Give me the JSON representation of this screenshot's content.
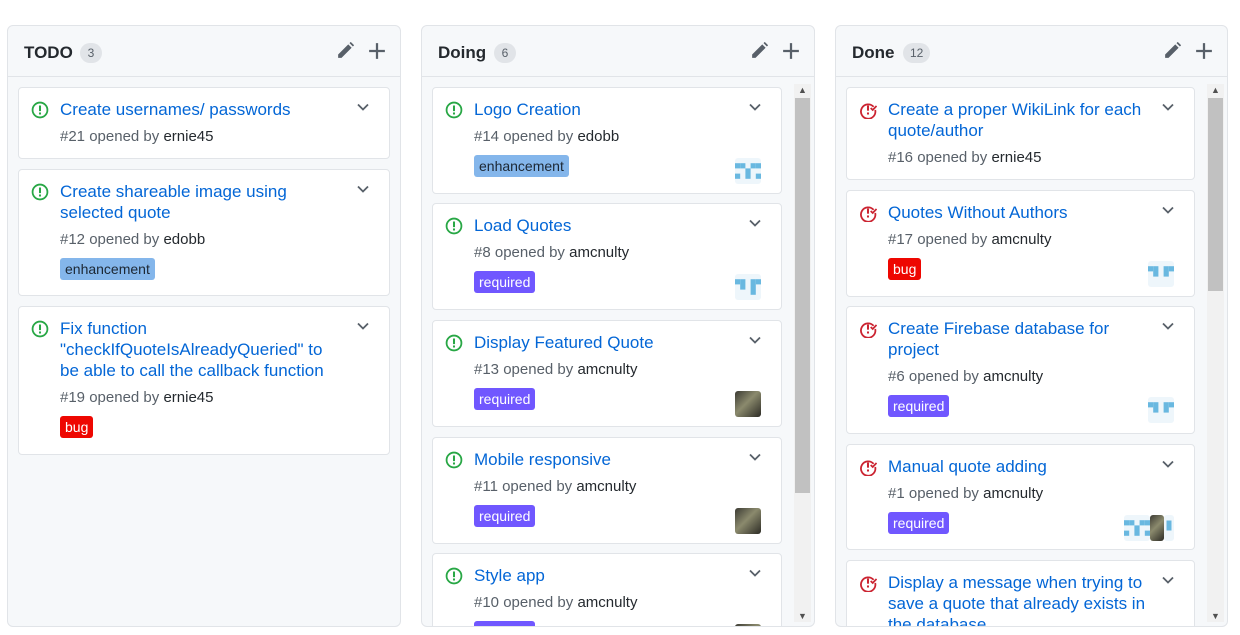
{
  "columns": [
    {
      "title": "TODO",
      "count": "3",
      "cards": [
        {
          "title": "Create usernames/ passwords",
          "number": "#21",
          "opened_by": "opened by",
          "author": "ernie45",
          "state": "open",
          "labels": [],
          "avatars": []
        },
        {
          "title": "Create shareable image using selected quote",
          "number": "#12",
          "opened_by": "opened by",
          "author": "edobb",
          "state": "open",
          "labels": [
            "enhancement"
          ],
          "avatars": []
        },
        {
          "title": "Fix function \"checkIfQuoteIsAlreadyQueried\" to be able to call the callback function",
          "number": "#19",
          "opened_by": "opened by",
          "author": "ernie45",
          "state": "open",
          "labels": [
            "bug"
          ],
          "avatars": []
        }
      ]
    },
    {
      "title": "Doing",
      "count": "6",
      "cards": [
        {
          "title": "Logo Creation",
          "number": "#14",
          "opened_by": "opened by",
          "author": "edobb",
          "state": "open",
          "labels": [
            "enhancement"
          ],
          "avatars": [
            "identicon"
          ]
        },
        {
          "title": "Load Quotes",
          "number": "#8",
          "opened_by": "opened by",
          "author": "amcnulty",
          "state": "open",
          "labels": [
            "required"
          ],
          "avatars": [
            "identicon"
          ]
        },
        {
          "title": "Display Featured Quote",
          "number": "#13",
          "opened_by": "opened by",
          "author": "amcnulty",
          "state": "open",
          "labels": [
            "required"
          ],
          "avatars": [
            "photo"
          ]
        },
        {
          "title": "Mobile responsive",
          "number": "#11",
          "opened_by": "opened by",
          "author": "amcnulty",
          "state": "open",
          "labels": [
            "required"
          ],
          "avatars": [
            "photo"
          ]
        },
        {
          "title": "Style app",
          "number": "#10",
          "opened_by": "opened by",
          "author": "amcnulty",
          "state": "open",
          "labels": [
            "required"
          ],
          "avatars": [
            "photo"
          ]
        }
      ]
    },
    {
      "title": "Done",
      "count": "12",
      "cards": [
        {
          "title": "Create a proper WikiLink for each quote/author",
          "number": "#16",
          "opened_by": "opened by",
          "author": "ernie45",
          "state": "closed",
          "labels": [],
          "avatars": []
        },
        {
          "title": "Quotes Without Authors",
          "number": "#17",
          "opened_by": "opened by",
          "author": "amcnulty",
          "state": "closed",
          "labels": [
            "bug"
          ],
          "avatars": [
            "identicon"
          ]
        },
        {
          "title": "Create Firebase database for project",
          "number": "#6",
          "opened_by": "opened by",
          "author": "amcnulty",
          "state": "closed",
          "labels": [
            "required"
          ],
          "avatars": [
            "identicon"
          ]
        },
        {
          "title": "Manual quote adding",
          "number": "#1",
          "opened_by": "opened by",
          "author": "amcnulty",
          "state": "closed",
          "labels": [
            "required"
          ],
          "avatars": [
            "identicon",
            "photo",
            "identicon"
          ]
        },
        {
          "title": "Display a message when trying to save a quote that already exists in the database",
          "number": "",
          "opened_by": "",
          "author": "",
          "state": "closed",
          "labels": [],
          "avatars": []
        }
      ]
    }
  ],
  "colors": {
    "open_icon": "#28a745",
    "closed_icon": "#cb2431",
    "link": "#0366d6",
    "enhancement": "#84b6eb",
    "required": "#7057ff",
    "bug": "#ee0701"
  },
  "icons": {
    "edit": "pencil-icon",
    "add": "plus-icon",
    "open_issue": "issue-opened-icon",
    "closed_issue": "issue-closed-icon",
    "menu": "chevron-down-icon"
  }
}
